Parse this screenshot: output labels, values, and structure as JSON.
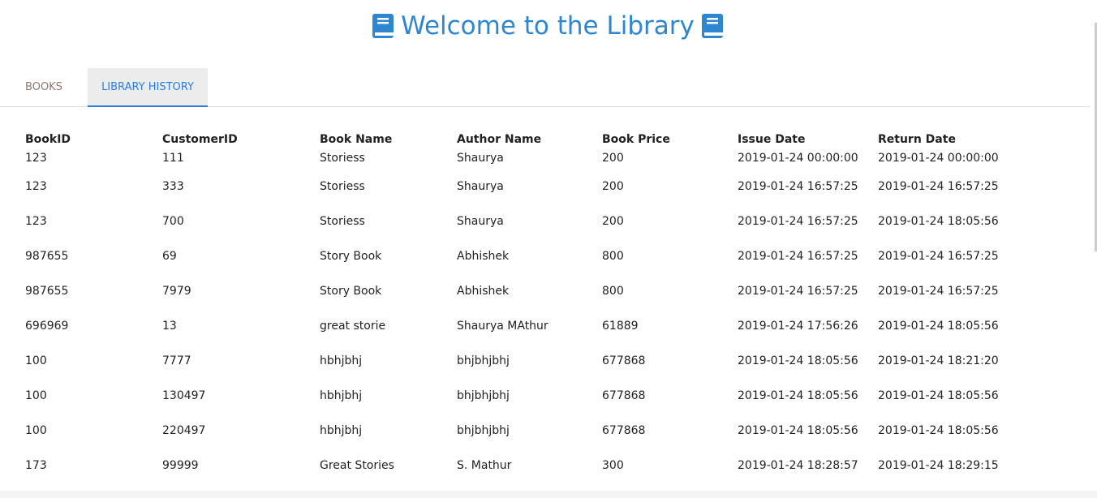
{
  "header": {
    "title": "Welcome to the Library",
    "icon": "book-icon",
    "color": "#2e86d0"
  },
  "tabs": [
    {
      "label": "BOOKS",
      "active": false
    },
    {
      "label": "LIBRARY HISTORY",
      "active": true
    }
  ],
  "table": {
    "columns": [
      "BookID",
      "CustomerID",
      "Book Name",
      "Author Name",
      "Book Price",
      "Issue Date",
      "Return Date"
    ],
    "rows": [
      [
        "123",
        "111",
        "Storiess",
        "Shaurya",
        "200",
        "2019-01-24 00:00:00",
        "2019-01-24 00:00:00"
      ],
      [
        "123",
        "333",
        "Storiess",
        "Shaurya",
        "200",
        "2019-01-24 16:57:25",
        "2019-01-24 16:57:25"
      ],
      [
        "123",
        "700",
        "Storiess",
        "Shaurya",
        "200",
        "2019-01-24 16:57:25",
        "2019-01-24 18:05:56"
      ],
      [
        "987655",
        "69",
        "Story Book",
        "Abhishek",
        "800",
        "2019-01-24 16:57:25",
        "2019-01-24 16:57:25"
      ],
      [
        "987655",
        "7979",
        "Story Book",
        "Abhishek",
        "800",
        "2019-01-24 16:57:25",
        "2019-01-24 16:57:25"
      ],
      [
        "696969",
        "13",
        "great storie",
        "Shaurya MAthur",
        "61889",
        "2019-01-24 17:56:26",
        "2019-01-24 18:05:56"
      ],
      [
        "100",
        "7777",
        "hbhjbhj",
        "bhjbhjbhj",
        "677868",
        "2019-01-24 18:05:56",
        "2019-01-24 18:21:20"
      ],
      [
        "100",
        "130497",
        "hbhjbhj",
        "bhjbhjbhj",
        "677868",
        "2019-01-24 18:05:56",
        "2019-01-24 18:05:56"
      ],
      [
        "100",
        "220497",
        "hbhjbhj",
        "bhjbhjbhj",
        "677868",
        "2019-01-24 18:05:56",
        "2019-01-24 18:05:56"
      ],
      [
        "173",
        "99999",
        "Great Stories",
        "S. Mathur",
        "300",
        "2019-01-24 18:28:57",
        "2019-01-24 18:29:15"
      ]
    ]
  }
}
